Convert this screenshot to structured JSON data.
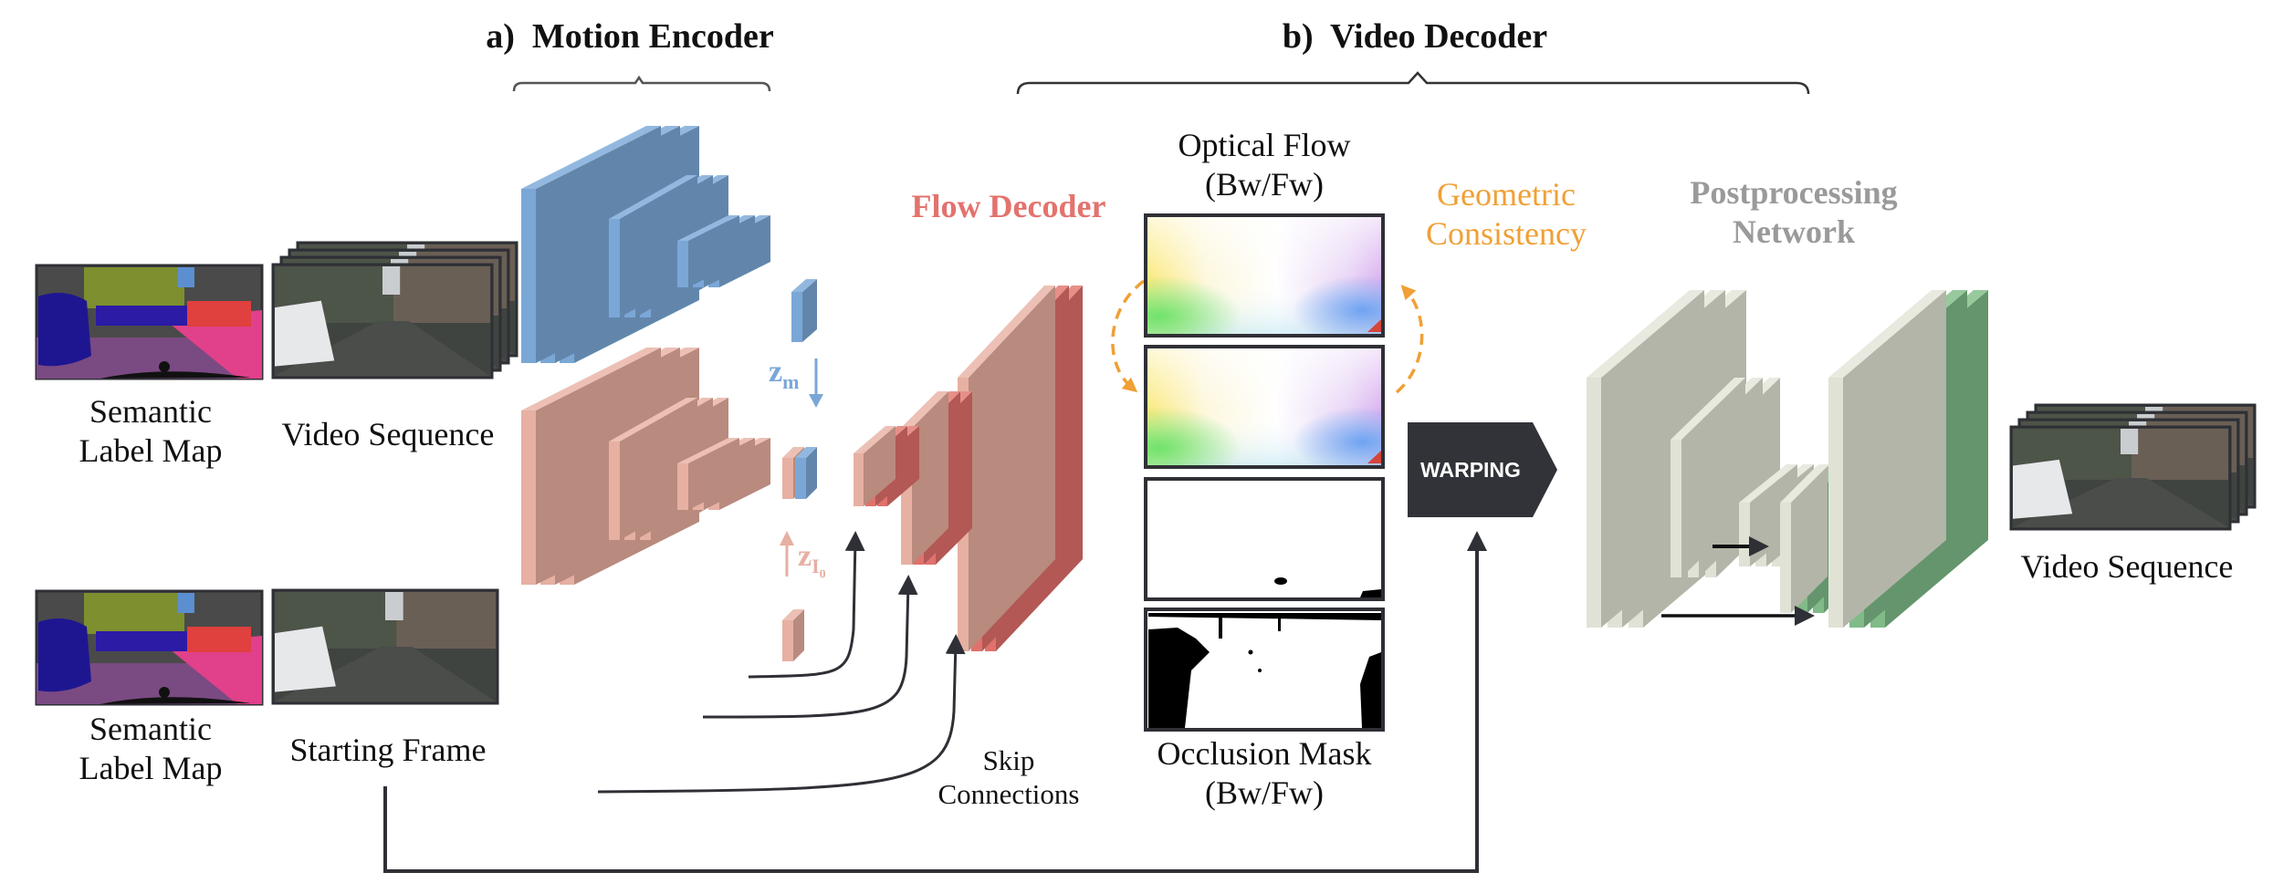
{
  "titles": {
    "motion_encoder": "a)  Motion Encoder",
    "video_decoder": "b)  Video Decoder"
  },
  "labels": {
    "flow_decoder": "Flow Decoder",
    "optical_flow_line1": "Optical Flow",
    "optical_flow_line2": "(Bw/Fw)",
    "geometric_line1": "Geometric",
    "geometric_line2": "Consistency",
    "postprocessing_line1": "Postprocessing",
    "postprocessing_line2": "Network",
    "occlusion_line1": "Occlusion Mask",
    "occlusion_line2": "(Bw/Fw)",
    "skip_line1": "Skip",
    "skip_line2": "Connections",
    "warping": "WARPING",
    "semantic_top_line1": "Semantic",
    "semantic_top_line2": "Label Map",
    "video_sequence_input": "Video Sequence",
    "semantic_bottom_line1": "Semantic",
    "semantic_bottom_line2": "Label Map",
    "starting_frame": "Starting Frame",
    "video_sequence_output": "Video Sequence",
    "z_m": "z",
    "z_m_sub": "m",
    "z_i0": "z",
    "z_i0_sub": "I",
    "z_i0_subsub": "0"
  },
  "colors": {
    "encoder_blue": "#7ba7d7",
    "encoder_pink": "#e6b0a3",
    "flow_red": "#e0716c",
    "geometric_orange": "#f0a035",
    "post_gray": "#e1e2d6",
    "post_green": "#80bb88",
    "warp_dark": "#323338",
    "flow_label": "#e3736d",
    "post_label": "#9a9a9a"
  }
}
